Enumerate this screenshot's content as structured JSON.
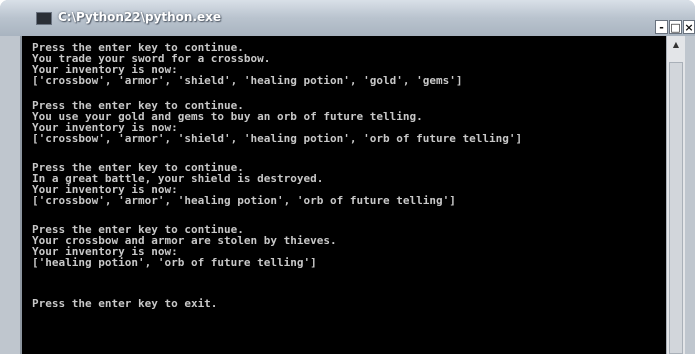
{
  "window": {
    "title": "C:\\Python22\\python.exe",
    "controls": {
      "minimize": "-",
      "maximize": "□",
      "close": "×"
    }
  },
  "console": {
    "lines": [
      "Press the enter key to continue.",
      "You trade your sword for a crossbow.",
      "Your inventory is now:",
      "['crossbow', 'armor', 'shield', 'healing potion', 'gold', 'gems']",
      "Press the enter key to continue.",
      "You use your gold and gems to buy an orb of future telling.",
      "Your inventory is now:",
      "['crossbow', 'armor', 'shield', 'healing potion', 'orb of future telling']",
      "Press the enter key to continue.",
      "In a great battle, your shield is destroyed.",
      "Your inventory is now:",
      "['crossbow', 'armor', 'healing potion', 'orb of future telling']",
      "Press the enter key to continue.",
      "Your crossbow and armor are stolen by thieves.",
      "Your inventory is now:",
      "['healing potion', 'orb of future telling']",
      "Press the enter key to exit."
    ]
  },
  "scrollbar": {
    "up_arrow": "▲"
  }
}
